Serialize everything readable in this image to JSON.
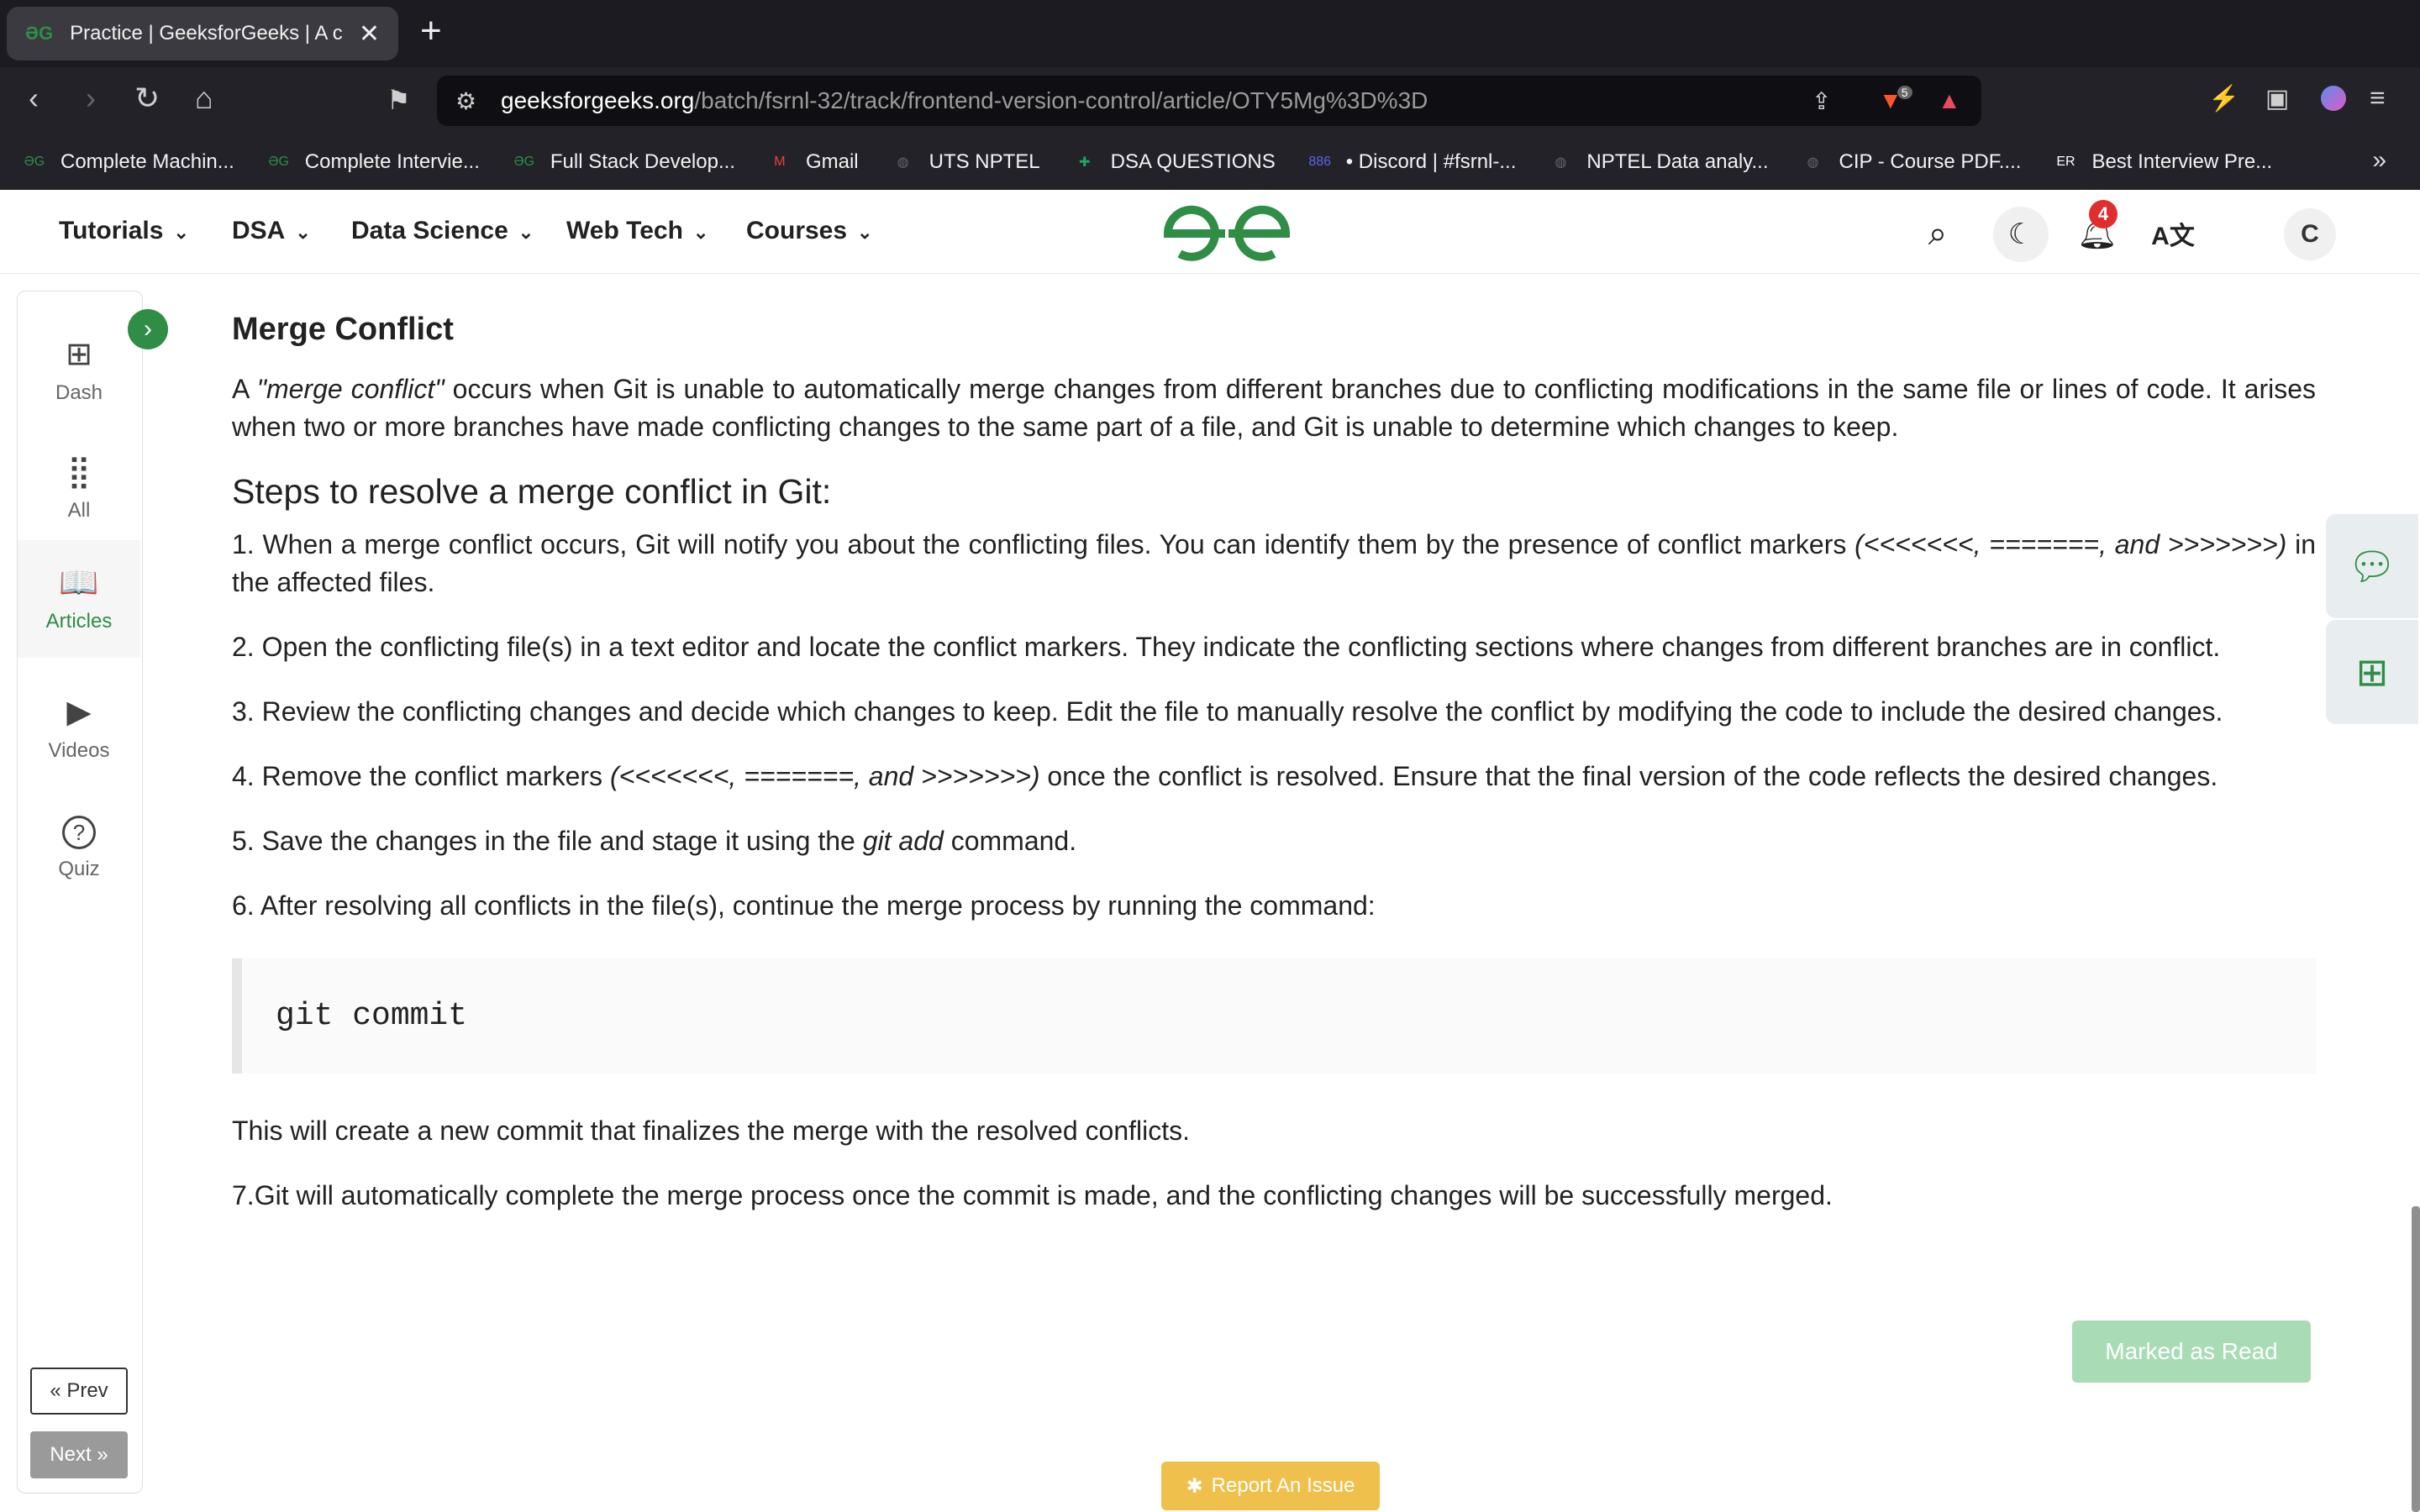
{
  "browser": {
    "tab_title": "Practice | GeeksforGeeks | A c",
    "tab_close": "✕",
    "new_tab": "+",
    "url_host": "geeksforgeeks.org",
    "url_path": "/batch/fsrnl-32/track/frontend-version-control/article/OTY5Mg%3D%3D",
    "brave_badge": "5"
  },
  "bookmarks": [
    {
      "label": "Complete Machin...",
      "icon": "gfg-icon",
      "color": "#2f8d46",
      "glyph": "ƏG"
    },
    {
      "label": "Complete Intervie...",
      "icon": "gfg-icon",
      "color": "#2f8d46",
      "glyph": "ƏG"
    },
    {
      "label": "Full Stack Develop...",
      "icon": "gfg-icon",
      "color": "#2f8d46",
      "glyph": "ƏG"
    },
    {
      "label": "Gmail",
      "icon": "gmail-icon",
      "color": "#ea4335",
      "glyph": "M"
    },
    {
      "label": "UTS NPTEL",
      "icon": "globe-icon",
      "color": "#666666",
      "glyph": "◍"
    },
    {
      "label": "DSA QUESTIONS",
      "icon": "sheets-icon",
      "color": "#1fa463",
      "glyph": "✚"
    },
    {
      "label": "• Discord | #fsrnl-...",
      "icon": "discord-icon",
      "color": "#5865f2",
      "glyph": "886"
    },
    {
      "label": "NPTEL Data analy...",
      "icon": "globe-icon",
      "color": "#666666",
      "glyph": "◍"
    },
    {
      "label": "CIP - Course PDF....",
      "icon": "globe-icon",
      "color": "#666666",
      "glyph": "◍"
    },
    {
      "label": "Best Interview Pre...",
      "icon": "er-icon",
      "color": "#ffffff",
      "glyph": "ER"
    }
  ],
  "nav": {
    "items": [
      "Tutorials",
      "DSA",
      "Data Science",
      "Web Tech",
      "Courses"
    ],
    "notification_count": "4",
    "avatar_initial": "C"
  },
  "sidebar": {
    "items": [
      {
        "label": "Dash",
        "glyph": "⊞"
      },
      {
        "label": "All",
        "glyph": "⣿"
      },
      {
        "label": "Articles",
        "glyph": "📖"
      },
      {
        "label": "Videos",
        "glyph": "▶"
      },
      {
        "label": "Quiz",
        "glyph": "?"
      }
    ],
    "active": "Articles",
    "prev_label": "« Prev",
    "next_label": "Next »"
  },
  "article": {
    "heading": "Merge Conflict",
    "intro_prefix": "A ",
    "intro_em": "\"merge conflict\"",
    "intro_suffix": " occurs when Git is unable to automatically merge changes from different branches due to conflicting modifications in the same file or lines of code. It arises when two or more branches have made conflicting changes to the same part of a file, and Git is unable to determine which changes to keep.",
    "steps_heading": "Steps to resolve a merge conflict in Git:",
    "step1_a": "1. When a merge conflict occurs, Git will notify you about the conflicting files. You can identify them by the presence of conflict markers ",
    "step1_em": "(<<<<<<<, =======, and >>>>>>>)",
    "step1_b": " in the affected files.",
    "step2": "2. Open the conflicting file(s) in a text editor and locate the conflict markers. They indicate the conflicting sections where changes from different branches are in conflict.",
    "step3": "3. Review the conflicting changes and decide which changes to keep. Edit the file to manually resolve the conflict by modifying the code to include the desired changes.",
    "step4_a": "4. Remove the conflict markers ",
    "step4_em": "(<<<<<<<, =======, and >>>>>>>)",
    "step4_b": " once the conflict is resolved. Ensure that the final version of the code reflects the desired changes.",
    "step5_a": "5. Save the changes in the file and stage it using the ",
    "step5_em": "git add",
    "step5_b": " command.",
    "step6": "6. After resolving all conflicts in the file(s), continue the merge process by running the command:",
    "code": "git commit",
    "after_code": "This will create a new commit that finalizes the merge with the resolved conflicts.",
    "step7": "7.Git will automatically complete the merge process once the commit is made, and the conflicting changes will be successfully merged."
  },
  "actions": {
    "marked_label": "Marked as Read",
    "report_label": "Report An Issue"
  },
  "colors": {
    "brand_green": "#2f8d46",
    "marked_bg": "#a9dcb5",
    "report_bg": "#efc04b",
    "badge_red": "#e02e2e"
  }
}
